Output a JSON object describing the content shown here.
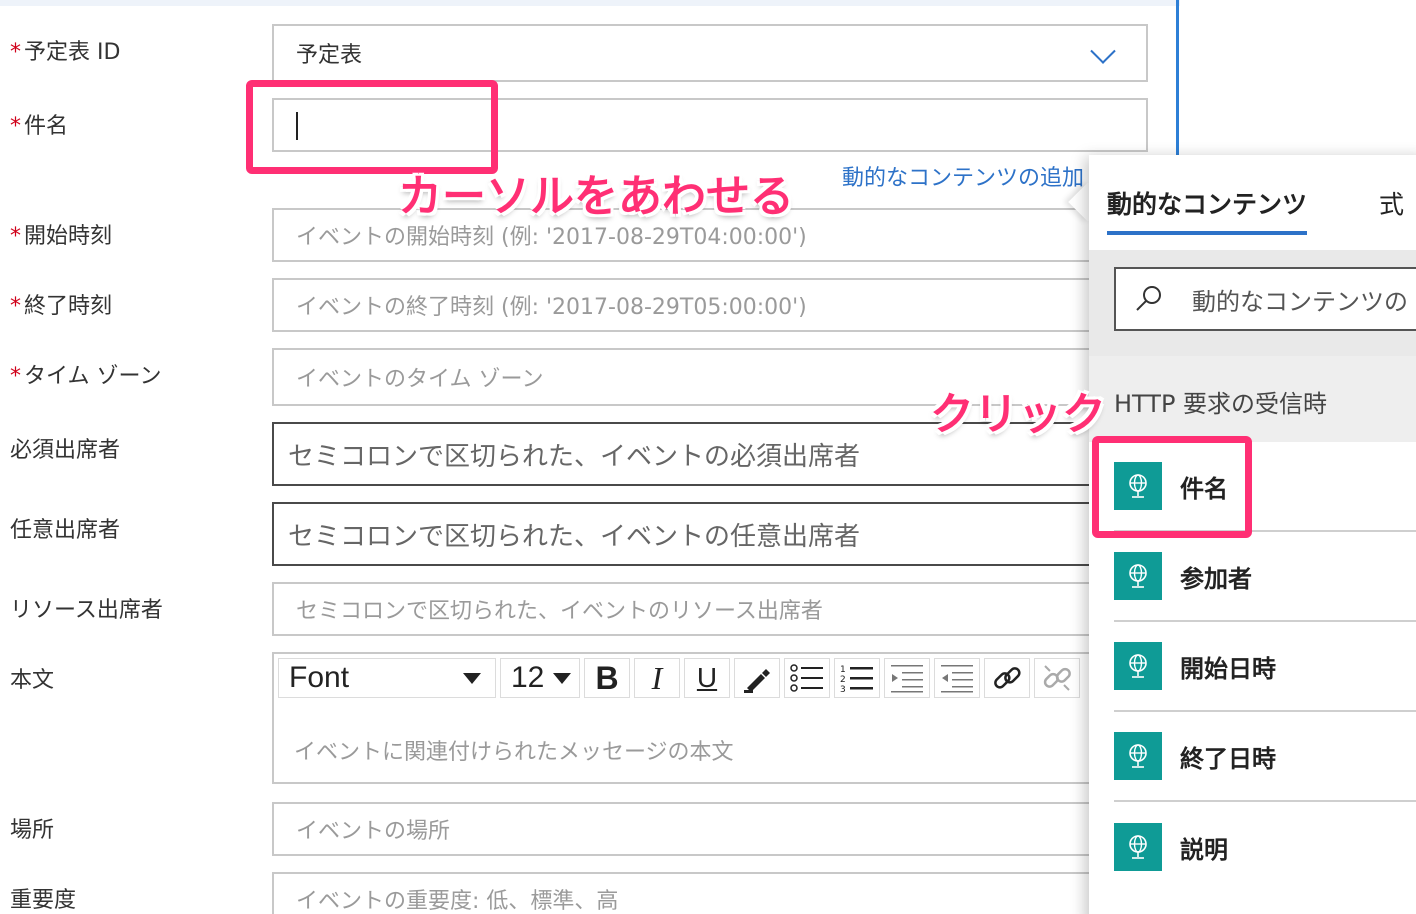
{
  "form": {
    "calendar_id": {
      "label": "予定表 ID",
      "value": "予定表"
    },
    "subject": {
      "label": "件名"
    },
    "dynamic_link": "動的なコンテンツの追加",
    "start_time": {
      "label": "開始時刻",
      "placeholder": "イベントの開始時刻 (例: '2017-08-29T04:00:00')"
    },
    "end_time": {
      "label": "終了時刻",
      "placeholder": "イベントの終了時刻 (例: '2017-08-29T05:00:00')"
    },
    "time_zone": {
      "label": "タイム ゾーン",
      "placeholder": "イベントのタイム ゾーン"
    },
    "required_attendees": {
      "label": "必須出席者",
      "placeholder": "セミコロンで区切られた、イベントの必須出席者"
    },
    "optional_attendees": {
      "label": "任意出席者",
      "placeholder": "セミコロンで区切られた、イベントの任意出席者"
    },
    "resource_attendees": {
      "label": "リソース出席者",
      "placeholder": "セミコロンで区切られた、イベントのリソース出席者"
    },
    "body": {
      "label": "本文",
      "placeholder": "イベントに関連付けられたメッセージの本文",
      "font": "Font",
      "font_size": "12",
      "bold": "B",
      "italic": "I",
      "underline": "U"
    },
    "location": {
      "label": "場所",
      "placeholder": "イベントの場所"
    },
    "importance": {
      "label": "重要度",
      "placeholder": "イベントの重要度: 低、標準、高"
    }
  },
  "annotations": {
    "cursor_note": "カーソルをあわせる",
    "click_note": "クリック"
  },
  "panel": {
    "tab_dynamic": "動的なコンテンツ",
    "tab_expression": "式",
    "search_placeholder": "動的なコンテンツの",
    "section_title": "HTTP 要求の受信時",
    "items": [
      {
        "name": "件名",
        "icon": "globe-icon"
      },
      {
        "name": "参加者",
        "icon": "globe-icon"
      },
      {
        "name": "開始日時",
        "icon": "globe-icon"
      },
      {
        "name": "終了日時",
        "icon": "globe-icon"
      },
      {
        "name": "説明",
        "icon": "globe-icon"
      }
    ]
  },
  "colors": {
    "accent": "#2d72c8",
    "required": "#d0021b",
    "highlight": "#ff2f74",
    "icon_bg": "#0f9b96"
  }
}
